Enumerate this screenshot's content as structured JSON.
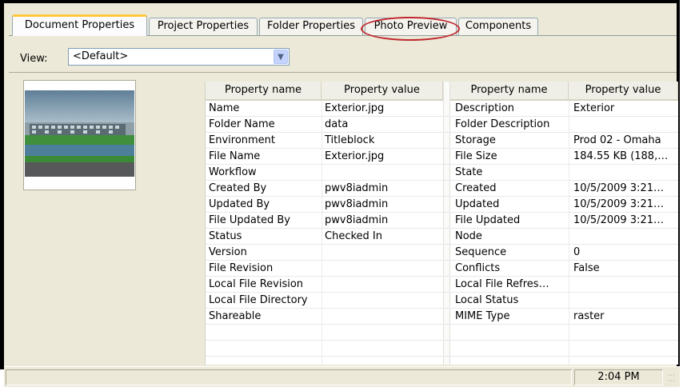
{
  "tabs": [
    {
      "label": "Document Properties",
      "active": true
    },
    {
      "label": "Project Properties",
      "active": false
    },
    {
      "label": "Folder Properties",
      "active": false
    },
    {
      "label": "Photo Preview",
      "active": false
    },
    {
      "label": "Components",
      "active": false
    }
  ],
  "view": {
    "label": "View:",
    "selected": "<Default>"
  },
  "grid": {
    "headers": [
      "Property name",
      "Property value",
      "Property name",
      "Property value"
    ],
    "rows": [
      [
        "Name",
        "Exterior.jpg",
        "Description",
        "Exterior"
      ],
      [
        "Folder Name",
        "data",
        "Folder Description",
        ""
      ],
      [
        "Environment",
        "Titleblock",
        "Storage",
        "Prod 02 - Omaha"
      ],
      [
        "File Name",
        "Exterior.jpg",
        "File Size",
        "184.55 KB (188,…"
      ],
      [
        "Workflow",
        "",
        "State",
        ""
      ],
      [
        "Created By",
        "pwv8iadmin",
        "Created",
        "10/5/2009 3:21…"
      ],
      [
        "Updated By",
        "pwv8iadmin",
        "Updated",
        "10/5/2009 3:21…"
      ],
      [
        "File Updated By",
        "pwv8iadmin",
        "File Updated",
        "10/5/2009 3:21…"
      ],
      [
        "Status",
        "Checked In",
        "Node",
        ""
      ],
      [
        "Version",
        "",
        "Sequence",
        "0"
      ],
      [
        "File Revision",
        "",
        "Conflicts",
        "False"
      ],
      [
        "Local File Revision",
        "",
        "Local File Refres…",
        ""
      ],
      [
        "Local File Directory",
        "",
        "Local Status",
        ""
      ],
      [
        "Shareable",
        "",
        "MIME Type",
        "raster"
      ]
    ]
  },
  "status_bar": {
    "time": "2:04 PM"
  },
  "colors": {
    "highlight_ellipse": "#c0282d",
    "active_tab_accent": "#ffc83c"
  },
  "icons": {
    "dropdown": "chevron-down-icon",
    "grip": "resize-grip-icon"
  }
}
